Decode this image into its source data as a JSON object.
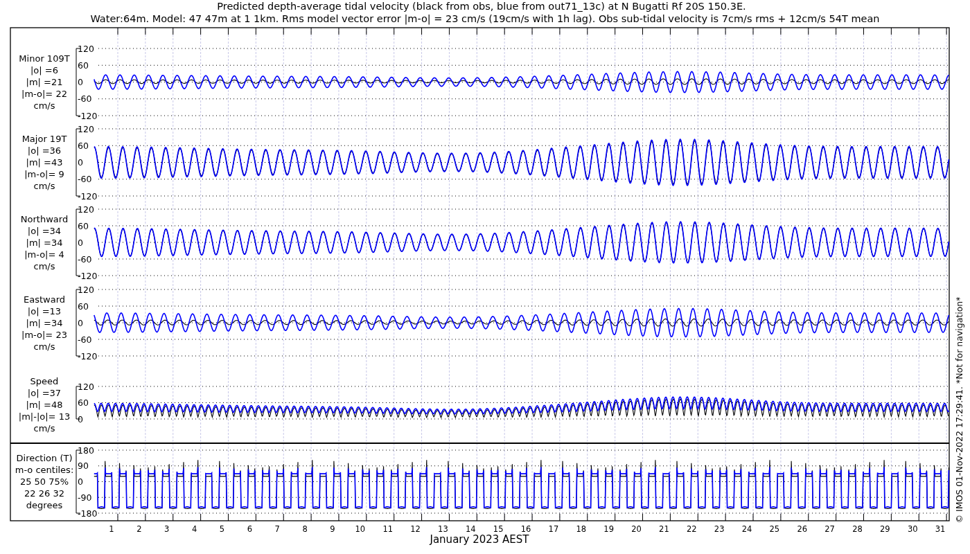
{
  "title_lines": [
    "Predicted depth-average tidal velocity (black from obs, blue from out71_13c) at N Bugatti Rf 20S 150.3E.",
    "Water:64m. Model: 47 47m at 1 1km. Rms model vector error |m-o| = 23 cm/s (19cm/s with 1h lag). Obs sub-tidal velocity is 7cm/s rms + 12cm/s 54T mean"
  ],
  "panels": [
    {
      "kind": "minor",
      "labels": [
        "Minor 109T",
        "|o| =6",
        "|m| =21",
        "|m-o|= 22",
        "cm/s"
      ],
      "yticks": [
        "120",
        "60",
        "0",
        "-60",
        "-120"
      ]
    },
    {
      "kind": "major",
      "labels": [
        "Major 19T",
        "|o| =36",
        "|m| =43",
        "|m-o|= 9",
        "cm/s"
      ],
      "yticks": [
        "120",
        "60",
        "0",
        "-60",
        "-120"
      ]
    },
    {
      "kind": "north",
      "labels": [
        "Northward",
        "|o| =34",
        "|m| =34",
        "|m-o|= 4",
        "cm/s"
      ],
      "yticks": [
        "120",
        "60",
        "0",
        "-60",
        "-120"
      ]
    },
    {
      "kind": "east",
      "labels": [
        "Eastward",
        "|o| =13",
        "|m| =34",
        "|m-o|= 23",
        "cm/s"
      ],
      "yticks": [
        "120",
        "60",
        "0",
        "-60",
        "-120"
      ]
    },
    {
      "kind": "speed",
      "labels": [
        "Speed",
        "|o| =37",
        "|m| =48",
        "|m|-|o|= 13",
        "cm/s"
      ],
      "yticks": [
        "120",
        "60",
        "0"
      ]
    },
    {
      "kind": "direction",
      "labels": [
        "Direction (T)",
        "m-o centiles:",
        "25  50  75%",
        "22  26  32",
        "degrees"
      ],
      "yticks": [
        "180",
        "90",
        "0",
        "-90",
        "-180"
      ]
    }
  ],
  "x_axis": {
    "days": [
      "1",
      "2",
      "3",
      "4",
      "5",
      "6",
      "7",
      "8",
      "9",
      "10",
      "11",
      "12",
      "13",
      "14",
      "15",
      "16",
      "17",
      "18",
      "19",
      "20",
      "21",
      "22",
      "23",
      "24",
      "25",
      "26",
      "27",
      "28",
      "29",
      "30",
      "31"
    ],
    "label": "January 2023 AEST"
  },
  "footer": "© IMOS 01-Nov-2022 17:29:41. *Not for navigation*"
}
